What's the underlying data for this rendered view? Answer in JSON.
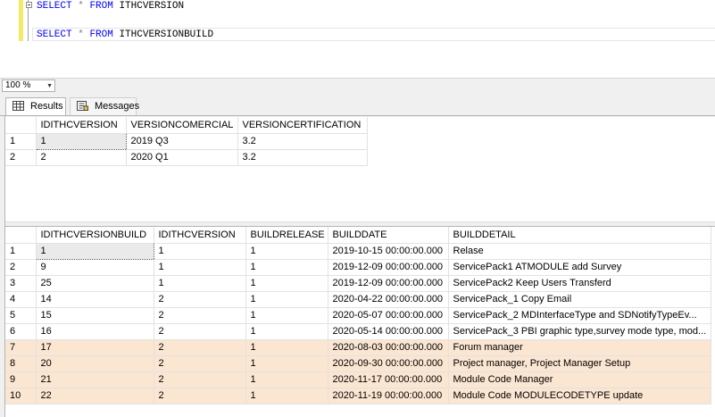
{
  "editor": {
    "line1": {
      "kw1": "SELECT",
      "star": "*",
      "kw2": "FROM",
      "table": "ITHCVERSION"
    },
    "line2": {
      "kw1": "SELECT",
      "star": "*",
      "kw2": "FROM",
      "table": "ITHCVERSIONBUILD"
    }
  },
  "zoom": {
    "value": "100 %"
  },
  "tabs": {
    "results": "Results",
    "messages": "Messages"
  },
  "grid1": {
    "columns": [
      "IDITHCVERSION",
      "VERSIONCOMERCIAL",
      "VERSIONCERTIFICATION"
    ],
    "rows": [
      {
        "n": "1",
        "cells": [
          "1",
          "2019 Q3",
          "3.2"
        ]
      },
      {
        "n": "2",
        "cells": [
          "2",
          "2020 Q1",
          "3.2"
        ]
      }
    ]
  },
  "grid2": {
    "columns": [
      "IDITHCVERSIONBUILD",
      "IDITHCVERSION",
      "BUILDRELEASE",
      "BUILDDATE",
      "BUILDDETAIL"
    ],
    "rows": [
      {
        "n": "1",
        "cells": [
          "1",
          "1",
          "1",
          "2019-10-15 00:00:00.000",
          "Relase"
        ]
      },
      {
        "n": "2",
        "cells": [
          "9",
          "1",
          "1",
          "2019-12-09 00:00:00.000",
          "ServicePack1 ATMODULE add Survey"
        ]
      },
      {
        "n": "3",
        "cells": [
          "25",
          "1",
          "1",
          "2019-12-09 00:00:00.000",
          "ServicePack2 Keep Users Transferd"
        ]
      },
      {
        "n": "4",
        "cells": [
          "14",
          "2",
          "1",
          "2020-04-22 00:00:00.000",
          "ServicePack_1 Copy Email"
        ]
      },
      {
        "n": "5",
        "cells": [
          "15",
          "2",
          "1",
          "2020-05-07 00:00:00.000",
          "ServicePack_2 MDInterfaceType and SDNotifyTypeEv..."
        ]
      },
      {
        "n": "6",
        "cells": [
          "16",
          "2",
          "1",
          "2020-05-14 00:00:00.000",
          "ServicePack_3 PBI graphic type,survey mode type, mod..."
        ]
      },
      {
        "n": "7",
        "cells": [
          "17",
          "2",
          "1",
          "2020-08-03 00:00:00.000",
          "Forum manager"
        ]
      },
      {
        "n": "8",
        "cells": [
          "20",
          "2",
          "1",
          "2020-09-30 00:00:00.000",
          "Project manager, Project Manager Setup"
        ]
      },
      {
        "n": "9",
        "cells": [
          "21",
          "2",
          "1",
          "2020-11-17 00:00:00.000",
          "Module Code Manager"
        ]
      },
      {
        "n": "10",
        "cells": [
          "22",
          "2",
          "1",
          "2020-11-19 00:00:00.000",
          "Module Code MODULECODETYPE update"
        ]
      }
    ]
  },
  "colors": {
    "keyword": "#0000ff",
    "highlight_row": "#fbe6d2",
    "editor_margin": "#f5e96a"
  },
  "icons": {
    "results_tab": "grid-icon",
    "messages_tab": "messages-icon",
    "zoom": "chevron-down-icon",
    "outline": "collapse-icon"
  }
}
